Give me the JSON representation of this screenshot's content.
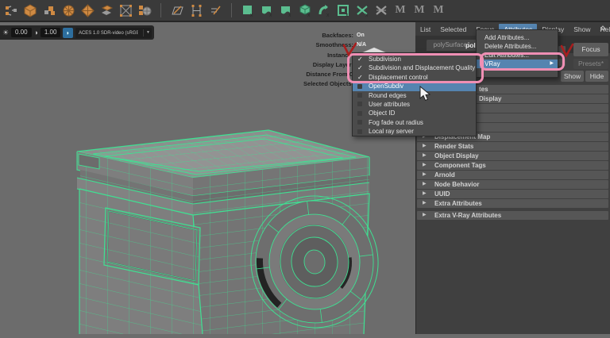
{
  "glyphs": {
    "check": "✓",
    "menu_arrow": "▶",
    "section_arrow": "▶",
    "dropdown_arrow": "▼",
    "sun": "☀",
    "contrast": "◑",
    "badge": "◗"
  },
  "colors": {
    "accent_blue": "#5584b0",
    "annotation_pink": "#ef8fb4",
    "annotation_red": "#a81e1e",
    "wireframe_green": "#3fe092"
  },
  "toolbar": {
    "m_buttons": [
      "M",
      "M",
      "M"
    ]
  },
  "viewport_bar": {
    "exposure_value": "0.00",
    "gamma_value": "1.00",
    "view_transform": "ACES 1.0 SDR-video (sRGB"
  },
  "hud": {
    "rows": [
      {
        "label": "Backfaces:",
        "value": "On"
      },
      {
        "label": "Smoothness:",
        "value": "N/A"
      },
      {
        "label": "Instance:",
        "value": ""
      },
      {
        "label": "Display Layer:",
        "value": ""
      },
      {
        "label": "Distance From C",
        "value": ""
      },
      {
        "label": "Selected Objects:",
        "value": ""
      }
    ]
  },
  "panel": {
    "menu": [
      "List",
      "Selected",
      "Focus",
      "Attributes",
      "Display",
      "Show",
      "Help"
    ],
    "active_menu": "Attributes",
    "tabs": [
      "polySurface1",
      "poly"
    ],
    "focus_button": "Focus",
    "presets_button": "Presets*",
    "show_button": "Show",
    "hide_button": "Hide",
    "sections": [
      "tes",
      "Display",
      "",
      "",
      "",
      "Displacement Map",
      "Render Stats",
      "Object Display",
      "Component Tags",
      "Arnold",
      "Node Behavior",
      "UUID",
      "Extra Attributes",
      "Extra V-Ray Attributes"
    ]
  },
  "attributes_menu": {
    "items": [
      "Add Attributes...",
      "Delete Attributes...",
      "Edit Attributes...",
      "VRay"
    ]
  },
  "vray_submenu": {
    "items": [
      {
        "label": "Subdivision",
        "checked": true
      },
      {
        "label": "Subdivision and Displacement Quality",
        "checked": true
      },
      {
        "label": "Displacement control",
        "checked": true
      },
      {
        "label": "OpenSubdiv",
        "checked": false
      },
      {
        "label": "Round edges",
        "checked": false
      },
      {
        "label": "User attributes",
        "checked": false
      },
      {
        "label": "Object ID",
        "checked": false
      },
      {
        "label": "Fog fade out radius",
        "checked": false
      },
      {
        "label": "Local ray server",
        "checked": false
      }
    ]
  }
}
